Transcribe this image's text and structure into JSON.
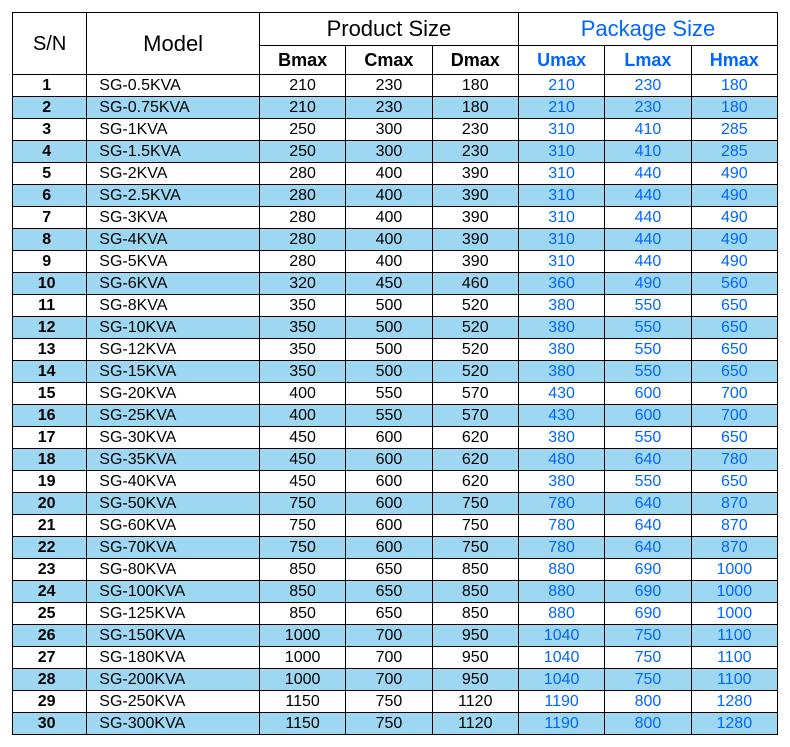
{
  "columns": {
    "sn": "S/N",
    "model": "Model",
    "product_size": "Product Size",
    "package_size": "Package Size",
    "bmax": "Bmax",
    "cmax": "Cmax",
    "dmax": "Dmax",
    "umax": "Umax",
    "lmax": "Lmax",
    "hmax": "Hmax"
  },
  "rows": [
    {
      "sn": "1",
      "model": "SG-0.5KVA",
      "bmax": "210",
      "cmax": "230",
      "dmax": "180",
      "umax": "210",
      "lmax": "230",
      "hmax": "180"
    },
    {
      "sn": "2",
      "model": "SG-0.75KVA",
      "bmax": "210",
      "cmax": "230",
      "dmax": "180",
      "umax": "210",
      "lmax": "230",
      "hmax": "180"
    },
    {
      "sn": "3",
      "model": "SG-1KVA",
      "bmax": "250",
      "cmax": "300",
      "dmax": "230",
      "umax": "310",
      "lmax": "410",
      "hmax": "285"
    },
    {
      "sn": "4",
      "model": "SG-1.5KVA",
      "bmax": "250",
      "cmax": "300",
      "dmax": "230",
      "umax": "310",
      "lmax": "410",
      "hmax": "285"
    },
    {
      "sn": "5",
      "model": "SG-2KVA",
      "bmax": "280",
      "cmax": "400",
      "dmax": "390",
      "umax": "310",
      "lmax": "440",
      "hmax": "490"
    },
    {
      "sn": "6",
      "model": "SG-2.5KVA",
      "bmax": "280",
      "cmax": "400",
      "dmax": "390",
      "umax": "310",
      "lmax": "440",
      "hmax": "490"
    },
    {
      "sn": "7",
      "model": "SG-3KVA",
      "bmax": "280",
      "cmax": "400",
      "dmax": "390",
      "umax": "310",
      "lmax": "440",
      "hmax": "490"
    },
    {
      "sn": "8",
      "model": "SG-4KVA",
      "bmax": "280",
      "cmax": "400",
      "dmax": "390",
      "umax": "310",
      "lmax": "440",
      "hmax": "490"
    },
    {
      "sn": "9",
      "model": "SG-5KVA",
      "bmax": "280",
      "cmax": "400",
      "dmax": "390",
      "umax": "310",
      "lmax": "440",
      "hmax": "490"
    },
    {
      "sn": "10",
      "model": "SG-6KVA",
      "bmax": "320",
      "cmax": "450",
      "dmax": "460",
      "umax": "360",
      "lmax": "490",
      "hmax": "560"
    },
    {
      "sn": "11",
      "model": "SG-8KVA",
      "bmax": "350",
      "cmax": "500",
      "dmax": "520",
      "umax": "380",
      "lmax": "550",
      "hmax": "650"
    },
    {
      "sn": "12",
      "model": "SG-10KVA",
      "bmax": "350",
      "cmax": "500",
      "dmax": "520",
      "umax": "380",
      "lmax": "550",
      "hmax": "650"
    },
    {
      "sn": "13",
      "model": "SG-12KVA",
      "bmax": "350",
      "cmax": "500",
      "dmax": "520",
      "umax": "380",
      "lmax": "550",
      "hmax": "650"
    },
    {
      "sn": "14",
      "model": "SG-15KVA",
      "bmax": "350",
      "cmax": "500",
      "dmax": "520",
      "umax": "380",
      "lmax": "550",
      "hmax": "650"
    },
    {
      "sn": "15",
      "model": "SG-20KVA",
      "bmax": "400",
      "cmax": "550",
      "dmax": "570",
      "umax": "430",
      "lmax": "600",
      "hmax": "700"
    },
    {
      "sn": "16",
      "model": "SG-25KVA",
      "bmax": "400",
      "cmax": "550",
      "dmax": "570",
      "umax": "430",
      "lmax": "600",
      "hmax": "700"
    },
    {
      "sn": "17",
      "model": "SG-30KVA",
      "bmax": "450",
      "cmax": "600",
      "dmax": "620",
      "umax": "380",
      "lmax": "550",
      "hmax": "650"
    },
    {
      "sn": "18",
      "model": "SG-35KVA",
      "bmax": "450",
      "cmax": "600",
      "dmax": "620",
      "umax": "480",
      "lmax": "640",
      "hmax": "780"
    },
    {
      "sn": "19",
      "model": "SG-40KVA",
      "bmax": "450",
      "cmax": "600",
      "dmax": "620",
      "umax": "380",
      "lmax": "550",
      "hmax": "650"
    },
    {
      "sn": "20",
      "model": "SG-50KVA",
      "bmax": "750",
      "cmax": "600",
      "dmax": "750",
      "umax": "780",
      "lmax": "640",
      "hmax": "870"
    },
    {
      "sn": "21",
      "model": "SG-60KVA",
      "bmax": "750",
      "cmax": "600",
      "dmax": "750",
      "umax": "780",
      "lmax": "640",
      "hmax": "870"
    },
    {
      "sn": "22",
      "model": "SG-70KVA",
      "bmax": "750",
      "cmax": "600",
      "dmax": "750",
      "umax": "780",
      "lmax": "640",
      "hmax": "870"
    },
    {
      "sn": "23",
      "model": "SG-80KVA",
      "bmax": "850",
      "cmax": "650",
      "dmax": "850",
      "umax": "880",
      "lmax": "690",
      "hmax": "1000"
    },
    {
      "sn": "24",
      "model": "SG-100KVA",
      "bmax": "850",
      "cmax": "650",
      "dmax": "850",
      "umax": "880",
      "lmax": "690",
      "hmax": "1000"
    },
    {
      "sn": "25",
      "model": "SG-125KVA",
      "bmax": "850",
      "cmax": "650",
      "dmax": "850",
      "umax": "880",
      "lmax": "690",
      "hmax": "1000"
    },
    {
      "sn": "26",
      "model": "SG-150KVA",
      "bmax": "1000",
      "cmax": "700",
      "dmax": "950",
      "umax": "1040",
      "lmax": "750",
      "hmax": "1100"
    },
    {
      "sn": "27",
      "model": "SG-180KVA",
      "bmax": "1000",
      "cmax": "700",
      "dmax": "950",
      "umax": "1040",
      "lmax": "750",
      "hmax": "1100"
    },
    {
      "sn": "28",
      "model": "SG-200KVA",
      "bmax": "1000",
      "cmax": "700",
      "dmax": "950",
      "umax": "1040",
      "lmax": "750",
      "hmax": "1100"
    },
    {
      "sn": "29",
      "model": "SG-250KVA",
      "bmax": "1150",
      "cmax": "750",
      "dmax": "1120",
      "umax": "1190",
      "lmax": "800",
      "hmax": "1280"
    },
    {
      "sn": "30",
      "model": "SG-300KVA",
      "bmax": "1150",
      "cmax": "750",
      "dmax": "1120",
      "umax": "1190",
      "lmax": "800",
      "hmax": "1280"
    }
  ]
}
